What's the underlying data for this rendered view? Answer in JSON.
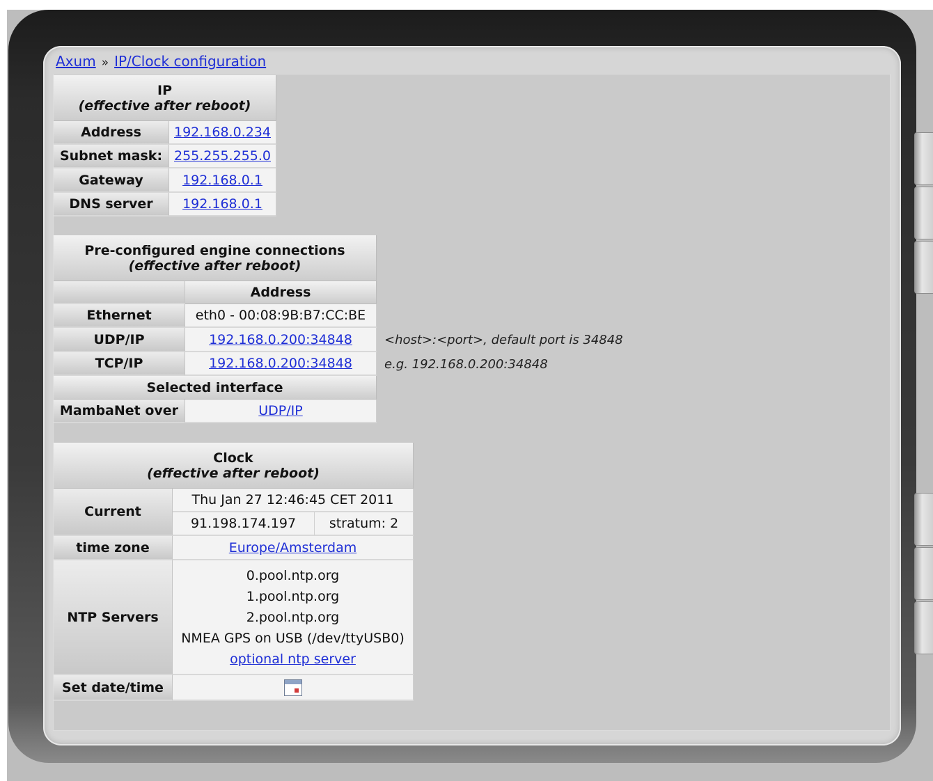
{
  "breadcrumb": {
    "home": "Axum",
    "separator": "»",
    "current": "IP/Clock configuration"
  },
  "ip": {
    "title": "IP",
    "subtitle": "(effective after reboot)",
    "rows": [
      {
        "label": "Address",
        "value": "192.168.0.234"
      },
      {
        "label": "Subnet mask:",
        "value": "255.255.255.0"
      },
      {
        "label": "Gateway",
        "value": "192.168.0.1"
      },
      {
        "label": "DNS server",
        "value": "192.168.0.1"
      }
    ]
  },
  "engine": {
    "title": "Pre-configured engine connections",
    "subtitle": "(effective after reboot)",
    "address_header": "Address",
    "ethernet": {
      "label": "Ethernet",
      "value": "eth0 - 00:08:9B:B7:CC:BE"
    },
    "udp": {
      "label": "UDP/IP",
      "value": "192.168.0.200:34848",
      "note": "<host>:<port>, default port is 34848"
    },
    "tcp": {
      "label": "TCP/IP",
      "value": "192.168.0.200:34848",
      "note": "e.g. 192.168.0.200:34848"
    },
    "selected_header": "Selected interface",
    "mambanet": {
      "label": "MambaNet over",
      "value": "UDP/IP"
    }
  },
  "clock": {
    "title": "Clock",
    "subtitle": "(effective after reboot)",
    "current_label": "Current",
    "current_time": "Thu Jan 27 12:46:45 CET 2011",
    "current_server": "91.198.174.197",
    "current_stratum": "stratum: 2",
    "timezone_label": "time zone",
    "timezone_value": "Europe/Amsterdam",
    "ntp_label": "NTP Servers",
    "ntp_servers": [
      "0.pool.ntp.org",
      "1.pool.ntp.org",
      "2.pool.ntp.org",
      "NMEA GPS on USB (/dev/ttyUSB0)"
    ],
    "ntp_optional": "optional ntp server",
    "setdate_label": "Set date/time",
    "setdate_icon": "calendar-icon"
  },
  "colors": {
    "link": "#1f2fd6",
    "bezel": "#2b2b2b",
    "panel": "#cacaca"
  }
}
